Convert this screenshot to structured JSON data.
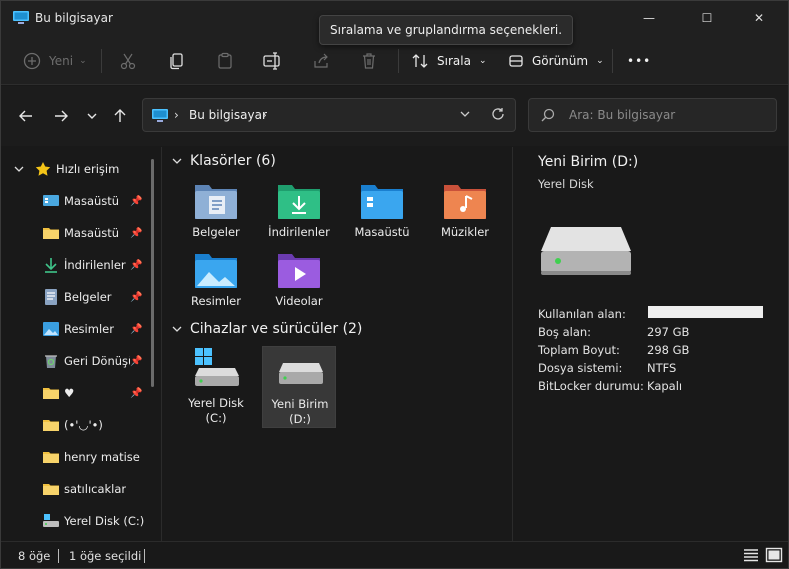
{
  "window": {
    "title": "Bu bilgisayar",
    "minimize_glyph": "—",
    "maximize_glyph": "☐",
    "close_glyph": "✕"
  },
  "tooltip": "Sıralama ve gruplandırma seçenekleri.",
  "toolbar": {
    "new_label": "Yeni",
    "sort_label": "Sırala",
    "view_label": "Görünüm",
    "more_glyph": "•••",
    "icons": [
      "plus-circle-icon",
      "cut-icon",
      "copy-icon",
      "paste-icon",
      "rename-icon",
      "share-icon",
      "delete-icon",
      "sort-icon",
      "view-icon",
      "more-icon"
    ]
  },
  "nav": {
    "breadcrumb": "Bu bilgisayar",
    "chevron": "›",
    "search_placeholder": "Ara: Bu bilgisayar"
  },
  "sidebar": {
    "quick_access": "Hızlı erişim",
    "items": [
      {
        "label": "Masaüstü",
        "icon": "desktop-icon",
        "pinned": true
      },
      {
        "label": "Masaüstü",
        "icon": "folder-icon",
        "pinned": true
      },
      {
        "label": "İndirilenler",
        "icon": "download-icon",
        "pinned": true
      },
      {
        "label": "Belgeler",
        "icon": "documents-icon",
        "pinned": true
      },
      {
        "label": "Resimler",
        "icon": "pictures-icon",
        "pinned": true
      },
      {
        "label": "Geri Dönüşü",
        "icon": "recycle-bin-icon",
        "pinned": true
      },
      {
        "label": "♥",
        "icon": "folder-icon",
        "pinned": true
      },
      {
        "label": "(•'◡'•)",
        "icon": "folder-icon",
        "pinned": false
      },
      {
        "label": "henry matise",
        "icon": "folder-icon",
        "pinned": false
      },
      {
        "label": "satılıcaklar",
        "icon": "folder-icon",
        "pinned": false
      },
      {
        "label": "Yerel Disk (C:)",
        "icon": "drive-icon",
        "pinned": false
      }
    ]
  },
  "content": {
    "folders_header": "Klasörler (6)",
    "folders": [
      {
        "label": "Belgeler",
        "icon": "documents-folder-icon"
      },
      {
        "label": "İndirilenler",
        "icon": "downloads-folder-icon"
      },
      {
        "label": "Masaüstü",
        "icon": "desktop-folder-icon"
      },
      {
        "label": "Müzikler",
        "icon": "music-folder-icon"
      },
      {
        "label": "Resimler",
        "icon": "pictures-folder-icon"
      },
      {
        "label": "Videolar",
        "icon": "videos-folder-icon"
      }
    ],
    "drives_header": "Cihazlar ve sürücüler (2)",
    "drives": [
      {
        "line1": "Yerel Disk",
        "line2": "(C:)",
        "icon": "windows-drive-icon",
        "selected": false
      },
      {
        "line1": "Yeni Birim",
        "line2": "(D:)",
        "icon": "drive-icon",
        "selected": true
      }
    ]
  },
  "details": {
    "title": "Yeni Birim (D:)",
    "subtitle": "Yerel Disk",
    "used_label": "Kullanılan alan:",
    "used_fraction": 0.0,
    "free_label": "Boş alan:",
    "free_value": "297 GB",
    "total_label": "Toplam Boyut:",
    "total_value": "298 GB",
    "fs_label": "Dosya sistemi:",
    "fs_value": "NTFS",
    "bitlocker_label": "BitLocker durumu:",
    "bitlocker_value": "Kapalı"
  },
  "status": {
    "count": "8 öğe",
    "selected": "1 öğe seçildi"
  },
  "colors": {
    "folder": "#f0c040",
    "accent": "#4cc2ff",
    "download": "#3fc48a",
    "music": "#e9764a",
    "video": "#9b5ce0"
  }
}
